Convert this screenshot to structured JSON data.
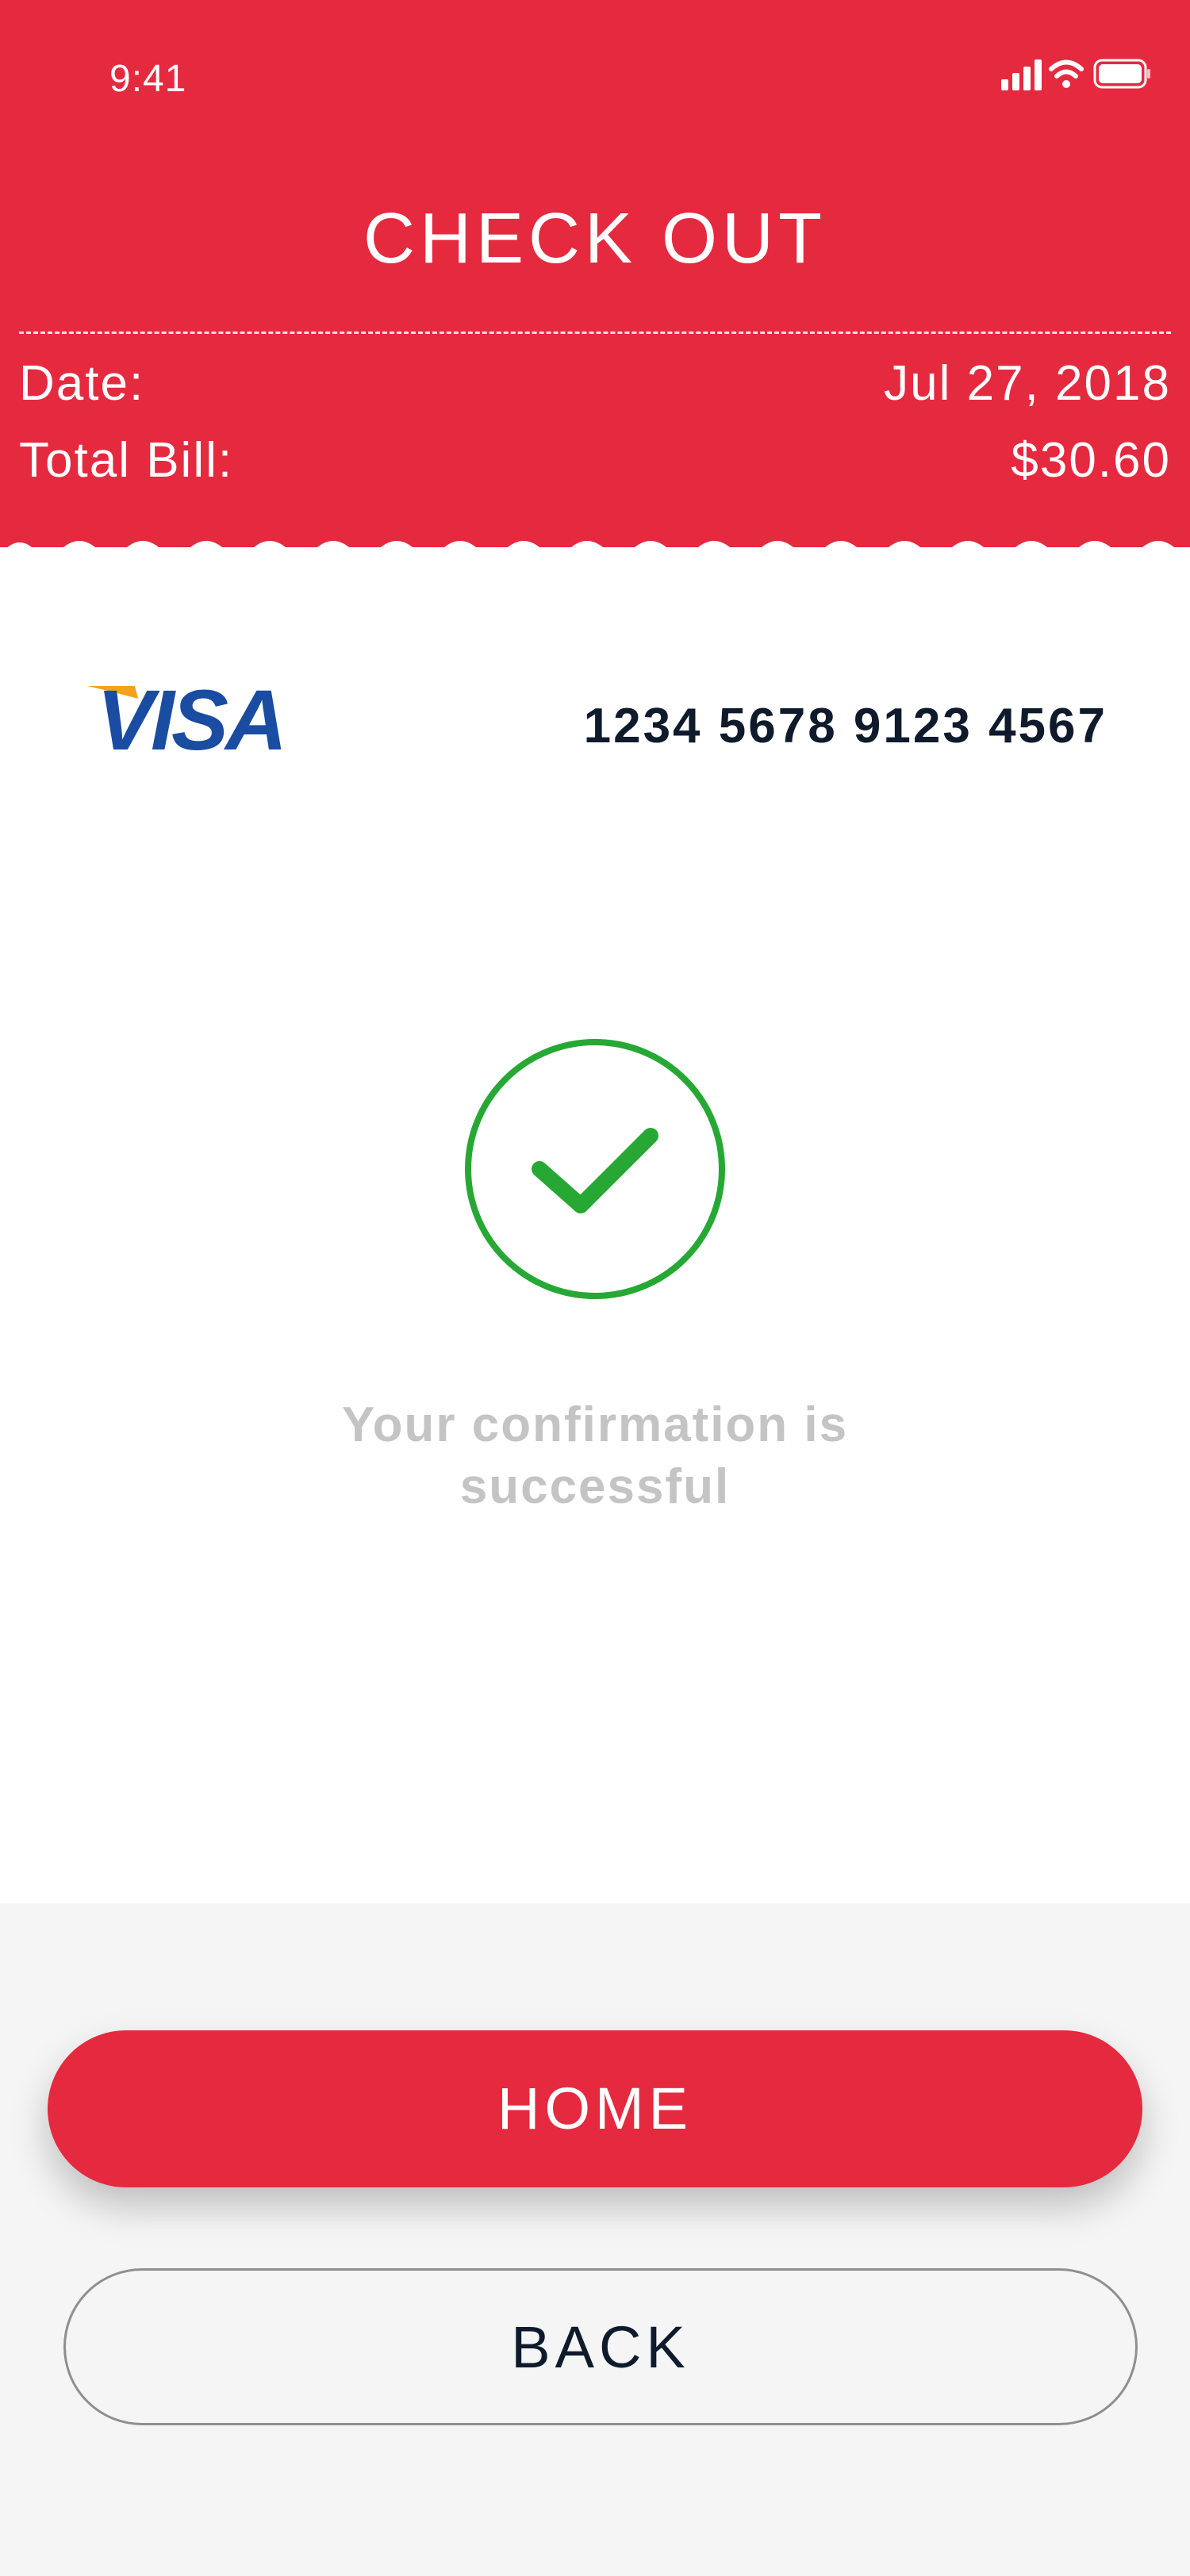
{
  "status_bar": {
    "time": "9:41"
  },
  "header": {
    "title": "CHECK OUT",
    "date_label": "Date:",
    "date_value": "Jul 27, 2018",
    "total_label": "Total Bill:",
    "total_value": "$30.60"
  },
  "card": {
    "brand": "VISA",
    "number": "1234 5678 9123 4567"
  },
  "confirmation": {
    "line1": "Your confirmation is",
    "line2": "successful"
  },
  "buttons": {
    "home_label": "HOME",
    "back_label": "BACK"
  },
  "colors": {
    "brand_red": "#e5293f",
    "success_green": "#27a835",
    "visa_blue": "#1a4da1",
    "visa_gold": "#f4a21c",
    "text_dark": "#0f1b2d",
    "muted_text": "#c4c4c4"
  },
  "icons": [
    "cellular-signal-icon",
    "wifi-icon",
    "battery-icon",
    "visa-logo",
    "checkmark-icon"
  ]
}
